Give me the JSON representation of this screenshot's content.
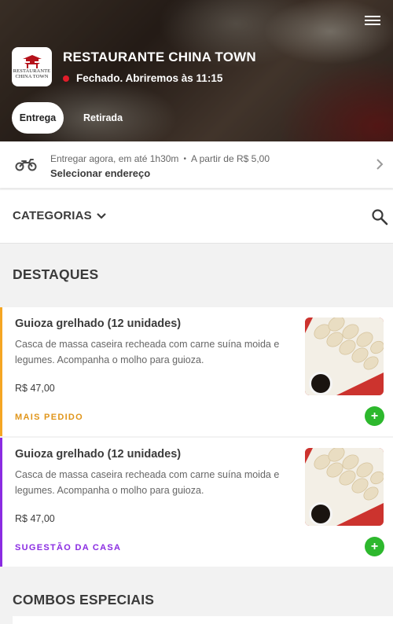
{
  "restaurant": {
    "name": "RESTAURANTE CHINA TOWN",
    "status": "Fechado. Abriremos às 11:15",
    "logo_line1": "RESTAURANTE",
    "logo_line2": "CHINA TOWN"
  },
  "tabs": [
    {
      "label": "Entrega",
      "active": true
    },
    {
      "label": "Retirada",
      "active": false
    }
  ],
  "delivery": {
    "time_text": "Entregar agora, em até 1h30m",
    "separator": "•",
    "min_text": "A partir de R$ 5,00",
    "address_cta": "Selecionar endereço"
  },
  "categories": {
    "label": "CATEGORIAS"
  },
  "sections": {
    "highlights_title": "DESTAQUES",
    "combos_title": "COMBOS ESPECIAIS"
  },
  "products": [
    {
      "title": "Guioza grelhado (12 unidades)",
      "description": "Casca de massa caseira recheada com carne suína moida e legumes. Acompanha o molho para guioza.",
      "price": "R$ 47,00",
      "tag": "MAIS PEDIDO",
      "accent_color": "#f5a623",
      "tag_color": "#e0951a"
    },
    {
      "title": "Guioza grelhado (12 unidades)",
      "description": "Casca de massa caseira recheada com carne suína moida e legumes. Acompanha o molho para guioza.",
      "price": "R$ 47,00",
      "tag": "SUGESTÃO DA CASA",
      "accent_color": "#8a2be2",
      "tag_color": "#8a2be2"
    }
  ],
  "icons": {
    "menu": "hamburger-menu-icon",
    "status": "closed-status-dot-icon",
    "delivery": "motorcycle-icon",
    "chevron": "chevron-right-icon",
    "category_toggle": "chevron-down-icon",
    "search": "search-icon",
    "add": "plus-icon"
  },
  "colors": {
    "status_dot": "#e11d2a",
    "add_button": "#2db82d",
    "text_dark": "#3b3b3b"
  }
}
